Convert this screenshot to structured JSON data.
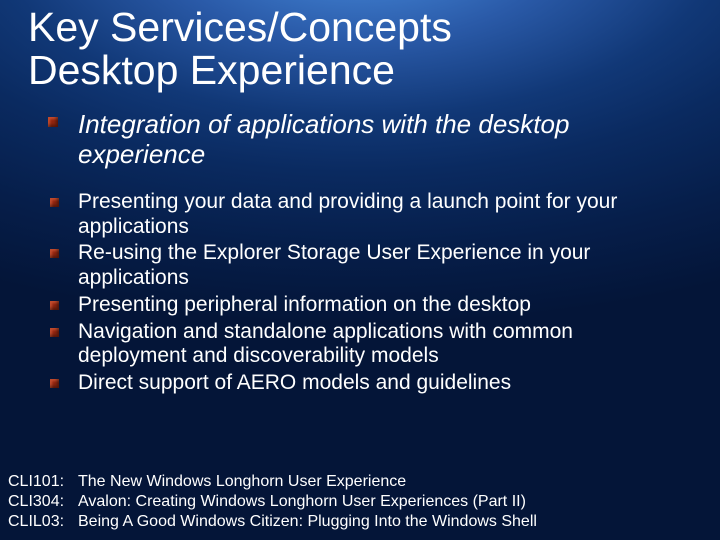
{
  "title": {
    "line1": "Key Services/Concepts",
    "line2": "Desktop Experience"
  },
  "lead": "Integration of applications with the desktop experience",
  "bullets": [
    "Presenting your data and providing a launch point for your applications",
    "Re-using the Explorer Storage User Experience in your applications",
    "Presenting peripheral information on the desktop",
    "Navigation and standalone applications with common deployment and discoverability models",
    "Direct support of AERO models and guidelines"
  ],
  "refs": [
    {
      "code": "CLI101:",
      "title": "The New Windows Longhorn User Experience"
    },
    {
      "code": "CLI304:",
      "title": "Avalon: Creating Windows Longhorn User Experiences (Part II)"
    },
    {
      "code": "CLIL03:",
      "title": "Being A Good Windows Citizen: Plugging Into the Windows Shell"
    }
  ]
}
